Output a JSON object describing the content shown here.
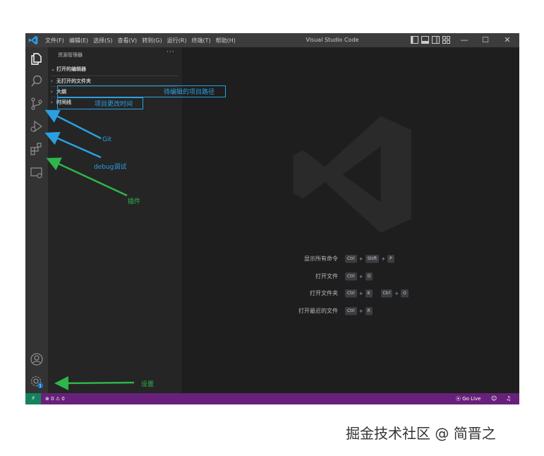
{
  "titlebar": {
    "menu": [
      "文件(F)",
      "编辑(E)",
      "选择(S)",
      "查看(V)",
      "转到(G)",
      "运行(R)",
      "终端(T)",
      "帮助(H)"
    ],
    "title": "Visual Studio Code",
    "minimize": "—",
    "maximize": "☐",
    "close": "✕"
  },
  "sidebar": {
    "title": "资源管理器",
    "more": "···",
    "open_editors": "打开的编辑器",
    "sections": [
      "无打开的文件夹",
      "大纲",
      "时间线"
    ]
  },
  "welcome": {
    "shortcuts": [
      {
        "label": "显示所有命令",
        "keys": [
          [
            "Ctrl",
            "Shift",
            "P"
          ]
        ]
      },
      {
        "label": "打开文件",
        "keys": [
          [
            "Ctrl",
            "O"
          ]
        ]
      },
      {
        "label": "打开文件夹",
        "keys": [
          [
            "Ctrl",
            "K"
          ],
          [
            "Ctrl",
            "O"
          ]
        ]
      },
      {
        "label": "打开最近的文件",
        "keys": [
          [
            "Ctrl",
            "R"
          ]
        ]
      }
    ]
  },
  "statusbar": {
    "problems": "⊗ 0 ⚠ 0",
    "golive": "⦿ Go Live",
    "badge": "1"
  },
  "annotations": {
    "outline_path": "待编辑的项目路径",
    "timeline": "项目更改时间",
    "git": "Git",
    "debug": "debug调试",
    "extensions": "插件",
    "settings": "设置"
  },
  "colors": {
    "annotation_blue": "#2aa0e0",
    "annotation_green": "#2fb54a",
    "statusbar": "#68217a",
    "remote": "#16825d"
  },
  "icons": [
    "explorer-icon",
    "search-icon",
    "source-control-icon",
    "run-debug-icon",
    "extensions-icon",
    "remote-explorer-icon",
    "account-icon",
    "settings-gear-icon"
  ],
  "watermark": "掘金技术社区 @ 简晋之"
}
